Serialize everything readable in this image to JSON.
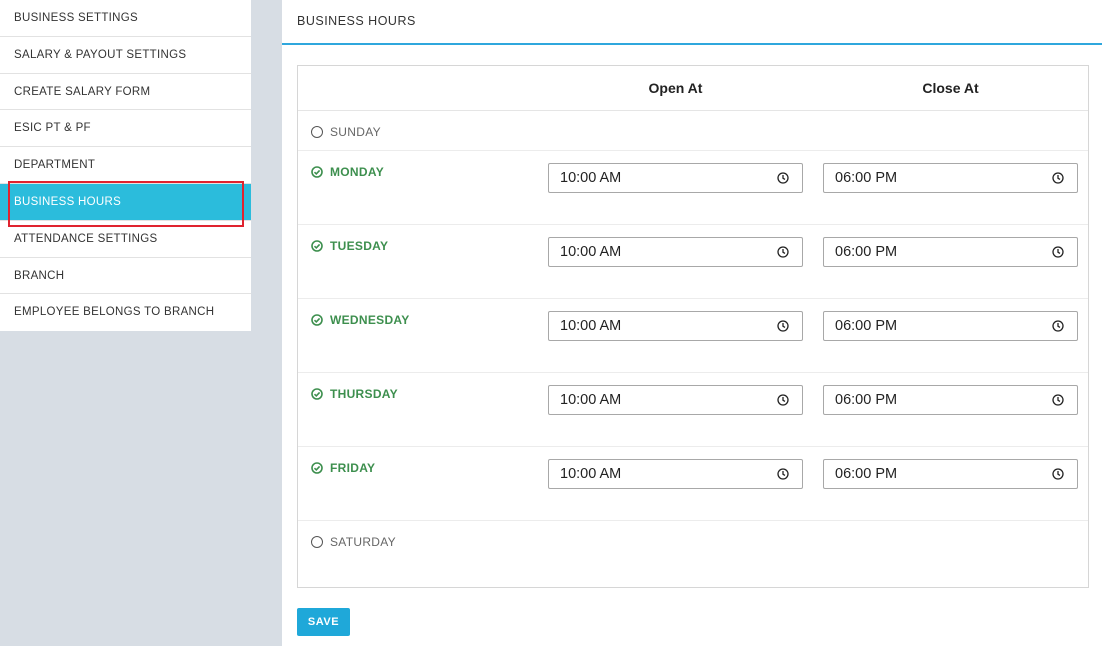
{
  "sidebar": {
    "items": [
      {
        "label": "BUSINESS SETTINGS"
      },
      {
        "label": "SALARY & PAYOUT SETTINGS"
      },
      {
        "label": "CREATE SALARY FORM"
      },
      {
        "label": "ESIC PT & PF"
      },
      {
        "label": "DEPARTMENT"
      },
      {
        "label": "BUSINESS HOURS",
        "active": true
      },
      {
        "label": "ATTENDANCE SETTINGS"
      },
      {
        "label": "BRANCH"
      },
      {
        "label": "EMPLOYEE BELONGS TO BRANCH"
      }
    ]
  },
  "header": {
    "title": "BUSINESS HOURS"
  },
  "table": {
    "open_header": "Open At",
    "close_header": "Close At",
    "rows": [
      {
        "day": "SUNDAY",
        "enabled": false
      },
      {
        "day": "MONDAY",
        "enabled": true,
        "open": "10:00 AM",
        "close": "06:00 PM"
      },
      {
        "day": "TUESDAY",
        "enabled": true,
        "open": "10:00 AM",
        "close": "06:00 PM"
      },
      {
        "day": "WEDNESDAY",
        "enabled": true,
        "open": "10:00 AM",
        "close": "06:00 PM"
      },
      {
        "day": "THURSDAY",
        "enabled": true,
        "open": "10:00 AM",
        "close": "06:00 PM"
      },
      {
        "day": "FRIDAY",
        "enabled": true,
        "open": "10:00 AM",
        "close": "06:00 PM"
      },
      {
        "day": "SATURDAY",
        "enabled": false
      }
    ]
  },
  "actions": {
    "save_label": "SAVE"
  },
  "colors": {
    "accent": "#2bbcdc",
    "enabled_day": "#3d8f4e",
    "save_button": "#1fa8d9",
    "highlight_border": "#e0232f"
  }
}
